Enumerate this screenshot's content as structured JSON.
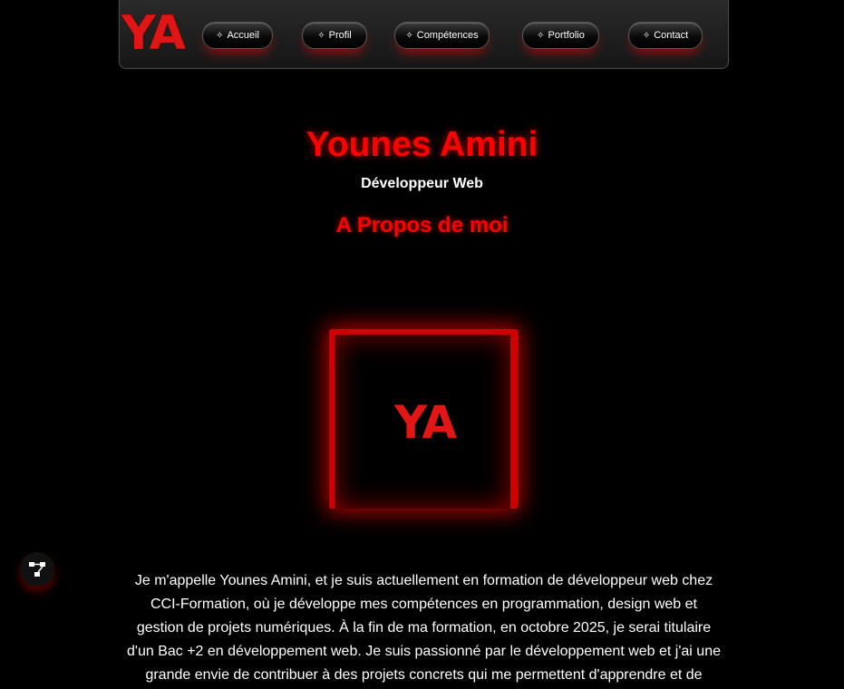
{
  "header": {
    "logo": "YA",
    "nav": [
      {
        "icon": "✧",
        "label": "Accueil"
      },
      {
        "icon": "✧",
        "label": "Profil"
      },
      {
        "icon": "✧",
        "label": "Compétences"
      },
      {
        "icon": "✧",
        "label": "Portfolio"
      },
      {
        "icon": "✧",
        "label": "Contact"
      }
    ]
  },
  "hero": {
    "name": "Younes Amini",
    "role": "Développeur Web",
    "section_title": "A Propos de moi",
    "photo_logo": "YA"
  },
  "bio": {
    "text": "Je m'appelle Younes Amini, et je suis actuellement en formation de développeur web chez CCI-Formation, où je développe mes compétences en programmation, design web et gestion de projets numériques. À la fin de ma formation, en octobre 2025, je serai titulaire d'un Bac +2 en développement web. Je suis passionné par le développement web et j'ai une grande envie de contribuer à des projets concrets qui me permettent d'apprendre et de"
  },
  "colors": {
    "accent": "#ff0000",
    "background": "#000000"
  },
  "icons": {
    "share": "share-icon"
  }
}
